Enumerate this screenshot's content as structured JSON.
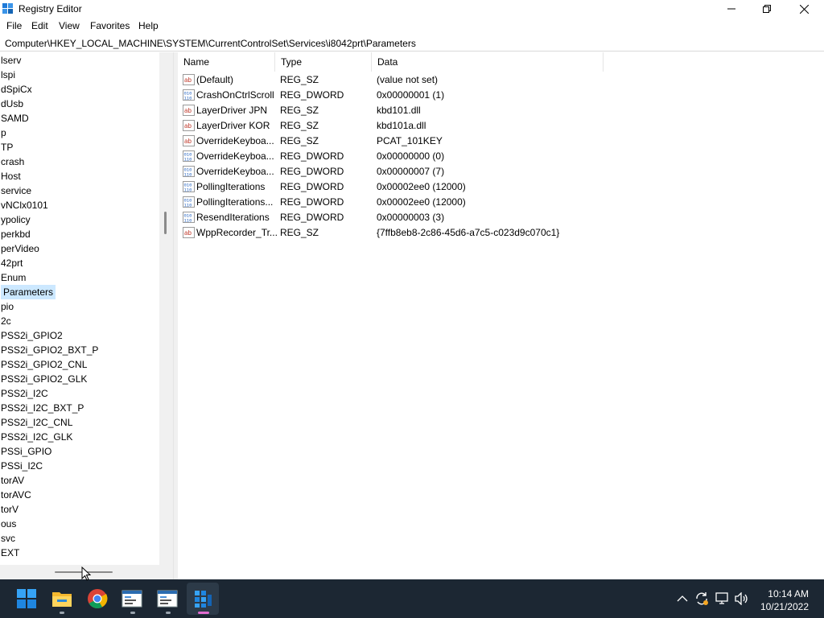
{
  "window": {
    "title": "Registry Editor",
    "menu": [
      "File",
      "Edit",
      "View",
      "Favorites",
      "Help"
    ],
    "address": "Computer\\HKEY_LOCAL_MACHINE\\SYSTEM\\CurrentControlSet\\Services\\i8042prt\\Parameters"
  },
  "tree": {
    "items": [
      "lserv",
      "lspi",
      "dSpiCx",
      "dUsb",
      "SAMD",
      "p",
      "TP",
      "crash",
      "Host",
      "service",
      "vNClx0101",
      "ypolicy",
      "perkbd",
      "perVideo",
      "42prt",
      "Enum",
      "Parameters",
      "pio",
      "2c",
      "PSS2i_GPIO2",
      "PSS2i_GPIO2_BXT_P",
      "PSS2i_GPIO2_CNL",
      "PSS2i_GPIO2_GLK",
      "PSS2i_I2C",
      "PSS2i_I2C_BXT_P",
      "PSS2i_I2C_CNL",
      "PSS2i_I2C_GLK",
      "PSSi_GPIO",
      "PSSi_I2C",
      "torAV",
      "torAVC",
      "torV",
      "ous",
      "svc",
      "EXT"
    ],
    "selected": "Parameters"
  },
  "list": {
    "columns": [
      "Name",
      "Type",
      "Data"
    ],
    "rows": [
      {
        "icon": "string-value-icon",
        "name": "(Default)",
        "type": "REG_SZ",
        "data": "(value not set)"
      },
      {
        "icon": "binary-value-icon",
        "name": "CrashOnCtrlScroll",
        "type": "REG_DWORD",
        "data": "0x00000001 (1)"
      },
      {
        "icon": "string-value-icon",
        "name": "LayerDriver JPN",
        "type": "REG_SZ",
        "data": "kbd101.dll"
      },
      {
        "icon": "string-value-icon",
        "name": "LayerDriver KOR",
        "type": "REG_SZ",
        "data": "kbd101a.dll"
      },
      {
        "icon": "string-value-icon",
        "name": "OverrideKeyboa...",
        "type": "REG_SZ",
        "data": "PCAT_101KEY"
      },
      {
        "icon": "binary-value-icon",
        "name": "OverrideKeyboa...",
        "type": "REG_DWORD",
        "data": "0x00000000 (0)"
      },
      {
        "icon": "binary-value-icon",
        "name": "OverrideKeyboa...",
        "type": "REG_DWORD",
        "data": "0x00000007 (7)"
      },
      {
        "icon": "binary-value-icon",
        "name": "PollingIterations",
        "type": "REG_DWORD",
        "data": "0x00002ee0 (12000)"
      },
      {
        "icon": "binary-value-icon",
        "name": "PollingIterations...",
        "type": "REG_DWORD",
        "data": "0x00002ee0 (12000)"
      },
      {
        "icon": "binary-value-icon",
        "name": "ResendIterations",
        "type": "REG_DWORD",
        "data": "0x00000003 (3)"
      },
      {
        "icon": "string-value-icon",
        "name": "WppRecorder_Tr...",
        "type": "REG_SZ",
        "data": "{7ffb8eb8-2c86-45d6-a7c5-c023d9c070c1}"
      }
    ]
  },
  "taskbar": {
    "apps": [
      "start-icon",
      "file-explorer-icon",
      "chrome-icon",
      "regedit-window-icon",
      "regedit-window-icon",
      "registry-editor-icon"
    ],
    "time": "10:14 AM",
    "date": "10/21/2022"
  },
  "colors": {
    "selection": "#cce8ff",
    "taskbar": "#1c2733",
    "accent": "#0078d4"
  }
}
